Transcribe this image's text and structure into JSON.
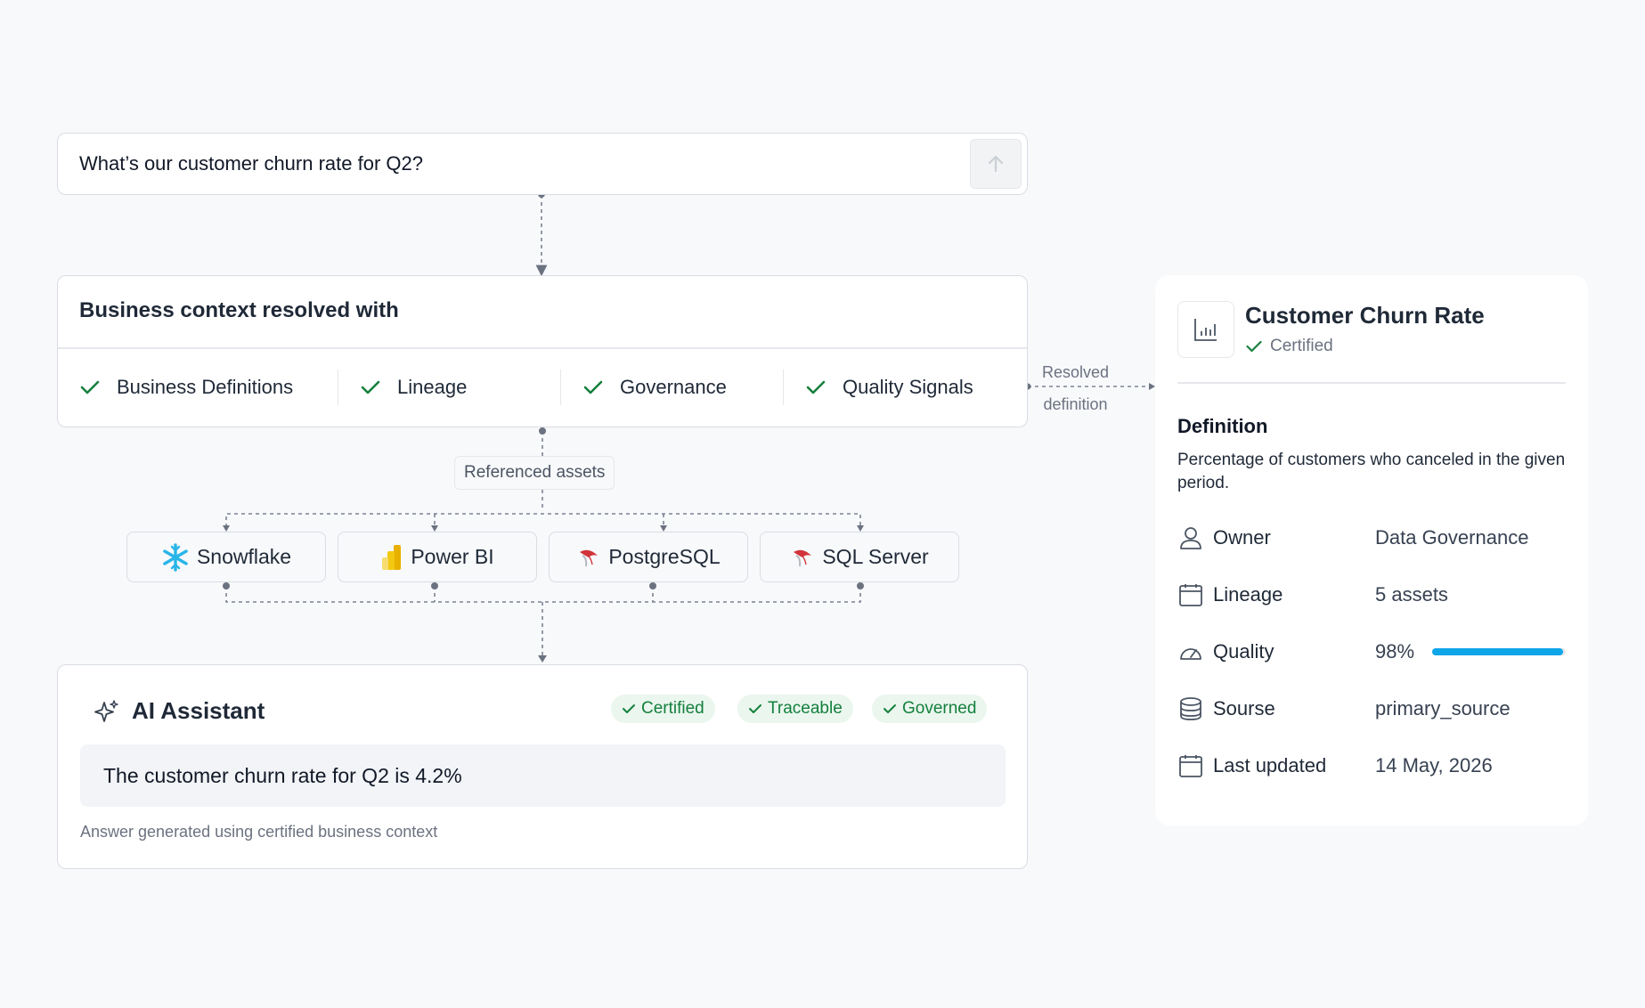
{
  "question": {
    "text": "What’s our customer churn rate for Q2?"
  },
  "context": {
    "title": "Business context resolved with",
    "items": [
      {
        "label": "Business Definitions"
      },
      {
        "label": "Lineage"
      },
      {
        "label": "Governance"
      },
      {
        "label": "Quality Signals"
      }
    ]
  },
  "resolved_link": {
    "line1": "Resolved",
    "line2": "definition"
  },
  "referenced_assets": {
    "label": "Referenced assets",
    "assets": [
      {
        "name": "Snowflake",
        "icon": "snowflake-icon"
      },
      {
        "name": "Power BI",
        "icon": "powerbi-icon"
      },
      {
        "name": "PostgreSQL",
        "icon": "database-logo-icon"
      },
      {
        "name": "SQL Server",
        "icon": "database-logo-icon"
      }
    ]
  },
  "assistant": {
    "title": "AI Assistant",
    "badges": [
      "Certified",
      "Traceable",
      "Governed"
    ],
    "answer": "The customer churn rate for Q2 is 4.2%",
    "note": "Answer generated using certified business context"
  },
  "metric": {
    "title": "Customer Churn Rate",
    "status": "Certified",
    "definition_heading": "Definition",
    "definition": "Percentage of customers who canceled in the given period.",
    "properties": {
      "owner": {
        "label": "Owner",
        "value": "Data Governance"
      },
      "lineage": {
        "label": "Lineage",
        "value": "5 assets"
      },
      "quality": {
        "label": "Quality",
        "value": "98%",
        "percent": 98
      },
      "source": {
        "label": "Sourse",
        "value": "primary_source"
      },
      "updated": {
        "label": "Last updated",
        "value": "14 May, 2026"
      }
    }
  },
  "colors": {
    "accent": "#0ea5e9",
    "success": "#15803d",
    "badge_bg": "#eaf6ee"
  }
}
